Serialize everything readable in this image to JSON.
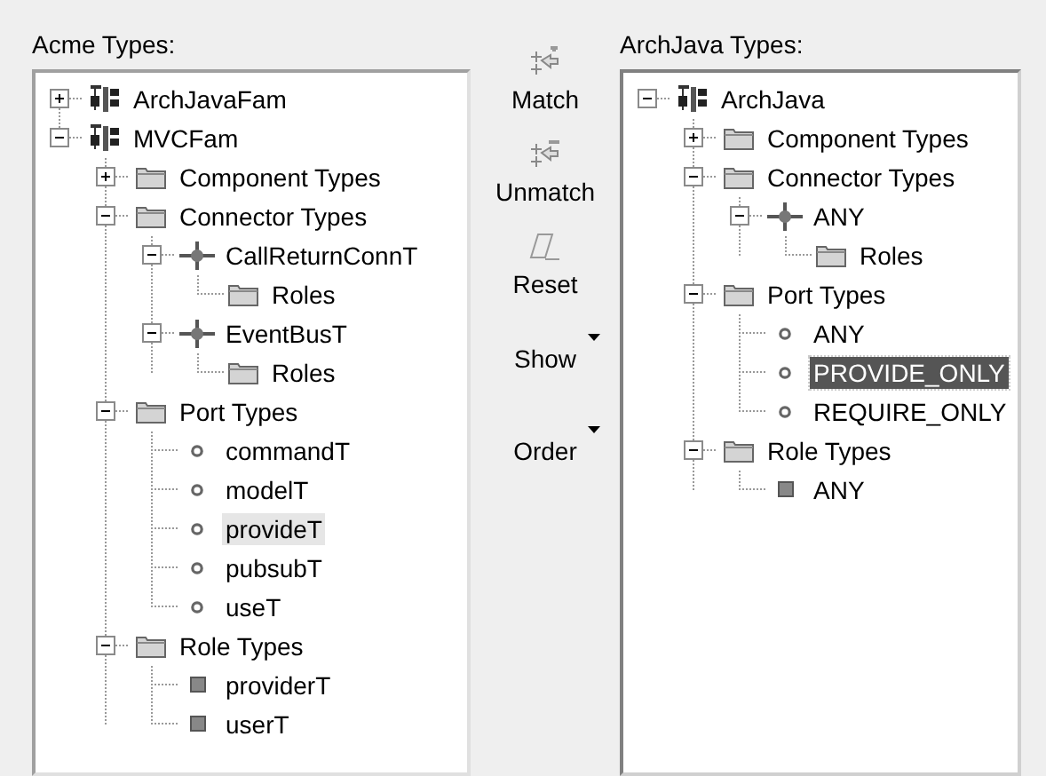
{
  "left_tree": {
    "title": "Acme Types:",
    "focused": false,
    "items": [
      {
        "label": "ArchJavaFam",
        "kind": "family",
        "expanded": false,
        "selected": false
      },
      {
        "label": "MVCFam",
        "kind": "family",
        "expanded": true,
        "selected": false,
        "children": [
          {
            "label": "Component Types",
            "kind": "folder",
            "expanded": false,
            "selected": false
          },
          {
            "label": "Connector Types",
            "kind": "folder",
            "expanded": true,
            "selected": false,
            "children": [
              {
                "label": "CallReturnConnT",
                "kind": "connector",
                "expanded": true,
                "selected": false,
                "children": [
                  {
                    "label": "Roles",
                    "kind": "folder",
                    "selected": false
                  }
                ]
              },
              {
                "label": "EventBusT",
                "kind": "connector",
                "expanded": true,
                "selected": false,
                "children": [
                  {
                    "label": "Roles",
                    "kind": "folder",
                    "selected": false
                  }
                ]
              }
            ]
          },
          {
            "label": "Port Types",
            "kind": "folder",
            "expanded": true,
            "selected": false,
            "children": [
              {
                "label": "commandT",
                "kind": "port",
                "selected": false
              },
              {
                "label": "modelT",
                "kind": "port",
                "selected": false
              },
              {
                "label": "provideT",
                "kind": "port",
                "selected": true
              },
              {
                "label": "pubsubT",
                "kind": "port",
                "selected": false
              },
              {
                "label": "useT",
                "kind": "port",
                "selected": false
              }
            ]
          },
          {
            "label": "Role Types",
            "kind": "folder",
            "expanded": true,
            "selected": false,
            "children": [
              {
                "label": "providerT",
                "kind": "role",
                "selected": false
              },
              {
                "label": "userT",
                "kind": "role",
                "selected": false
              }
            ]
          }
        ]
      }
    ]
  },
  "toolbar": [
    {
      "label": "Match",
      "kind": "match"
    },
    {
      "label": "Unmatch",
      "kind": "unmatch"
    },
    {
      "label": "Reset",
      "kind": "reset"
    },
    {
      "label": "Show",
      "kind": "dropdown"
    },
    {
      "label": "Order",
      "kind": "dropdown"
    }
  ],
  "right_tree": {
    "title": "ArchJava Types:",
    "focused": true,
    "items": [
      {
        "label": "ArchJava",
        "kind": "family",
        "expanded": true,
        "selected": false,
        "children": [
          {
            "label": "Component Types",
            "kind": "folder",
            "expanded": false,
            "selected": false
          },
          {
            "label": "Connector Types",
            "kind": "folder",
            "expanded": true,
            "selected": false,
            "children": [
              {
                "label": "ANY",
                "kind": "connector",
                "expanded": true,
                "selected": false,
                "children": [
                  {
                    "label": "Roles",
                    "kind": "folder",
                    "selected": false
                  }
                ]
              }
            ]
          },
          {
            "label": "Port Types",
            "kind": "folder",
            "expanded": true,
            "selected": false,
            "children": [
              {
                "label": "ANY",
                "kind": "port",
                "selected": false
              },
              {
                "label": "PROVIDE_ONLY",
                "kind": "port",
                "selected": true
              },
              {
                "label": "REQUIRE_ONLY",
                "kind": "port",
                "selected": false
              }
            ]
          },
          {
            "label": "Role Types",
            "kind": "folder",
            "expanded": true,
            "selected": false,
            "children": [
              {
                "label": "ANY",
                "kind": "role",
                "selected": false
              }
            ]
          }
        ]
      }
    ]
  }
}
